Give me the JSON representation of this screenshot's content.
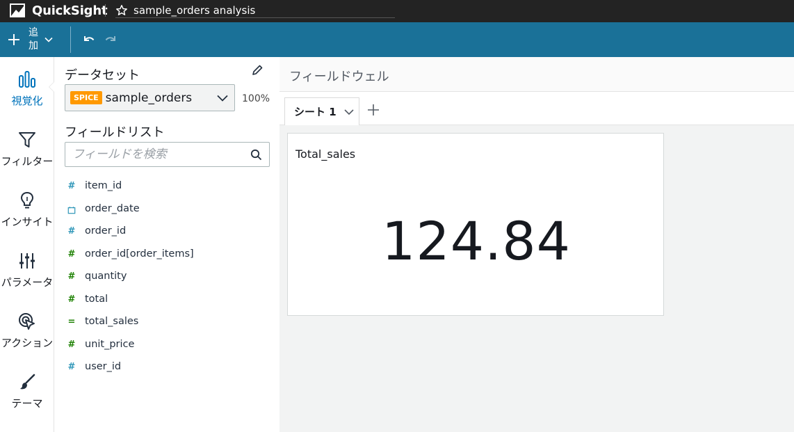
{
  "app": {
    "name": "QuickSight",
    "analysis_title": "sample_orders analysis"
  },
  "toolbar": {
    "add_label": "追加"
  },
  "nav": {
    "items": [
      {
        "label": "視覚化",
        "icon": "bar-chart-icon"
      },
      {
        "label": "フィルター",
        "icon": "filter-icon"
      },
      {
        "label": "インサイト",
        "icon": "lightbulb-icon"
      },
      {
        "label": "パラメータ",
        "icon": "sliders-icon"
      },
      {
        "label": "アクション",
        "icon": "cursor-click-icon"
      },
      {
        "label": "テーマ",
        "icon": "brush-icon"
      }
    ]
  },
  "panel": {
    "dataset_heading": "データセット",
    "spice_badge": "SPICE",
    "dataset_name": "sample_orders",
    "spice_percent": "100%",
    "field_list_heading": "フィールドリスト",
    "search_placeholder": "フィールドを検索",
    "fields": [
      {
        "name": "item_id",
        "icon": "#",
        "kind": "dimension"
      },
      {
        "name": "order_date",
        "icon": "calendar",
        "kind": "dimension"
      },
      {
        "name": "order_id",
        "icon": "#",
        "kind": "dimension"
      },
      {
        "name": "order_id[order_items]",
        "icon": "#",
        "kind": "measure"
      },
      {
        "name": "quantity",
        "icon": "#",
        "kind": "measure"
      },
      {
        "name": "total",
        "icon": "#",
        "kind": "measure"
      },
      {
        "name": "total_sales",
        "icon": "=",
        "kind": "measure"
      },
      {
        "name": "unit_price",
        "icon": "#",
        "kind": "measure"
      },
      {
        "name": "user_id",
        "icon": "#",
        "kind": "dimension"
      }
    ]
  },
  "content": {
    "field_wells_label": "フィールドウェル",
    "sheet_tab_label": "シート 1",
    "visual_title": "Total_sales",
    "kpi_value": "124.84"
  },
  "colors": {
    "toolbar": "#1a7198",
    "topbar": "#232323",
    "spice": "#ff9900",
    "active_nav": "#0073bb",
    "measure": "#1d8102",
    "dimension": "#2e96b8"
  }
}
